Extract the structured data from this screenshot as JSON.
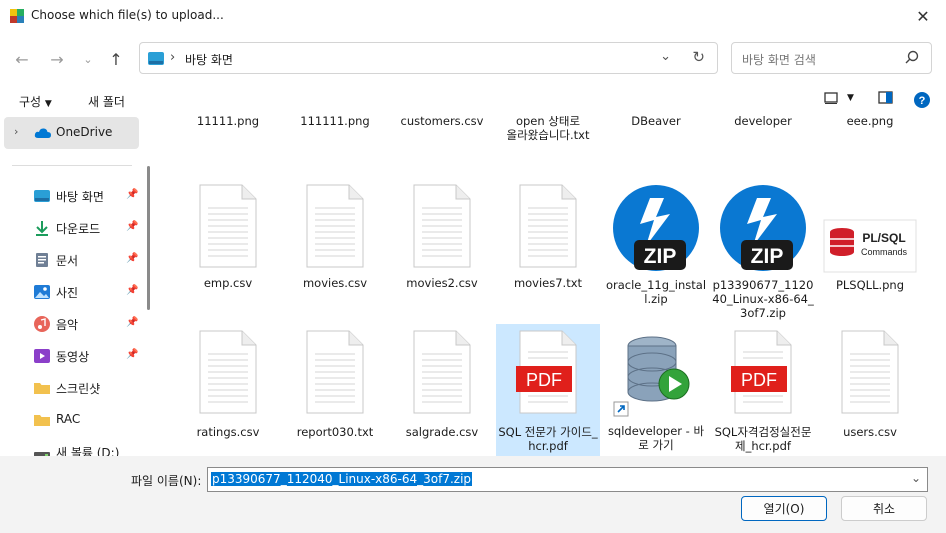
{
  "window": {
    "title": "Choose which file(s) to upload..."
  },
  "address": {
    "location": "바탕 화면"
  },
  "search": {
    "placeholder": "바탕 화면 검색"
  },
  "toolbar": {
    "organize": "구성",
    "new_folder": "새 폴더"
  },
  "sidebar": {
    "onedrive": "OneDrive",
    "items": [
      {
        "label": "바탕 화면",
        "icon": "desktop-icon"
      },
      {
        "label": "다운로드",
        "icon": "download-icon"
      },
      {
        "label": "문서",
        "icon": "document-icon"
      },
      {
        "label": "사진",
        "icon": "pictures-icon"
      },
      {
        "label": "음악",
        "icon": "music-icon"
      },
      {
        "label": "동영상",
        "icon": "video-icon"
      },
      {
        "label": "스크린샷",
        "icon": "folder-icon"
      },
      {
        "label": "RAC",
        "icon": "folder-icon"
      },
      {
        "label": "새 볼륨 (D:)",
        "icon": "drive-icon"
      }
    ]
  },
  "files": {
    "row0": [
      {
        "label": "11111.png"
      },
      {
        "label": "111111.png"
      },
      {
        "label": "customers.csv"
      },
      {
        "label": "db 가 만들어지면서 open 상태로 올라왔습니다.txt"
      },
      {
        "label": "DBeaver"
      },
      {
        "label": "developer"
      },
      {
        "label": "eee.png"
      }
    ],
    "row1": [
      {
        "label": "emp.csv",
        "type": "doc"
      },
      {
        "label": "movies.csv",
        "type": "doc"
      },
      {
        "label": "movies2.csv",
        "type": "doc"
      },
      {
        "label": "movies7.txt",
        "type": "doc"
      },
      {
        "label": "oracle_11g_install.zip",
        "type": "zip"
      },
      {
        "label": "p13390677_112040_Linux-x86-64_3of7.zip",
        "type": "zip"
      },
      {
        "label": "PLSQLL.png",
        "type": "plsql"
      }
    ],
    "row2": [
      {
        "label": "ratings.csv",
        "type": "doc"
      },
      {
        "label": "report030.txt",
        "type": "doc"
      },
      {
        "label": "salgrade.csv",
        "type": "doc"
      },
      {
        "label": "SQL 전문가 가이드_hcr.pdf",
        "type": "pdf"
      },
      {
        "label": "sqldeveloper - 바로 가기",
        "type": "db"
      },
      {
        "label": "SQL자격검정실전문제_hcr.pdf",
        "type": "pdf"
      },
      {
        "label": "users.csv",
        "type": "doc"
      }
    ],
    "zip_text": "ZIP",
    "pdf_text": "PDF",
    "plsql_text1": "PL/SQL",
    "plsql_text2": "Commands"
  },
  "filename": {
    "label": "파일 이름(N):",
    "value": "p13390677_112040_Linux-x86-64_3of7.zip"
  },
  "buttons": {
    "open": "열기(O)",
    "cancel": "취소"
  },
  "colors": {
    "accent": "#0078d4",
    "selection": "#cce8ff",
    "zip_blue": "#0a78d2",
    "pdf_red": "#e0201b"
  }
}
